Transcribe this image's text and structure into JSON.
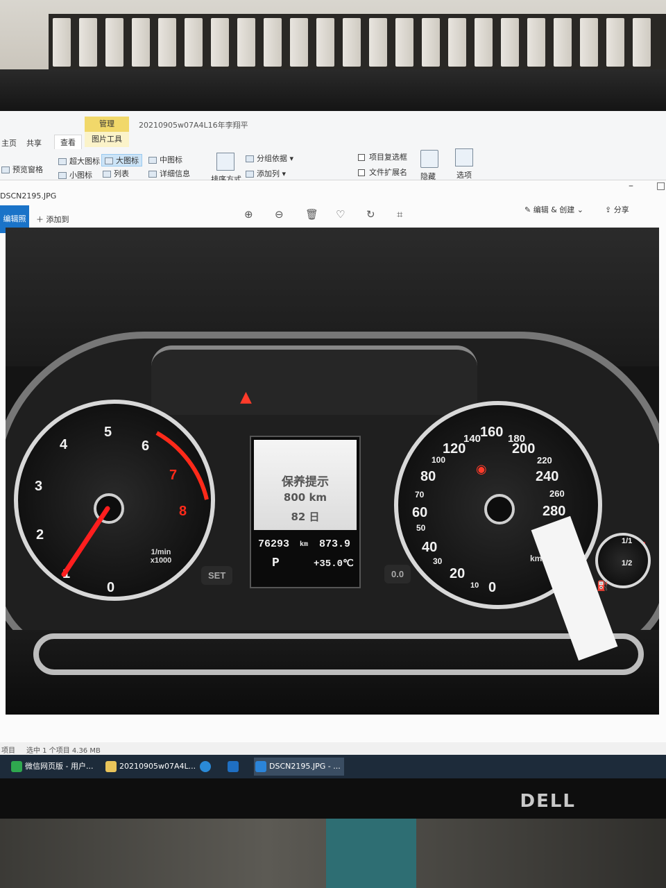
{
  "explorer": {
    "window_title": "20210905w07A4L16年李翔平",
    "context_tab": "管理",
    "context_tab_group": "图片工具",
    "tabs": [
      "主页",
      "共享",
      "查看"
    ],
    "panes": {
      "preview": "预览窗格"
    },
    "layout": {
      "extra_large": "超大图标",
      "large": "大图标",
      "medium": "中图标",
      "small": "小图标",
      "list": "列表",
      "details": "详细信息"
    },
    "current_view": {
      "sort": "排序方式",
      "group_by": "分组依据 ▾",
      "add_columns": "添加列 ▾"
    },
    "show_hide": {
      "item_checkboxes": "项目复选框",
      "file_extensions": "文件扩展名",
      "hide": "隐藏",
      "options": "选项"
    },
    "status": {
      "items": "项目",
      "selected": "选中 1 个项目  4.36 MB"
    }
  },
  "photos_app": {
    "file_name": "DSCN2195.JPG",
    "left_button": "编辑照片",
    "add_to": "添加到",
    "edit_create": "编辑 & 创建",
    "share": "分享",
    "tool_icons": [
      "zoom-in-icon",
      "zoom-out-icon",
      "delete-icon",
      "favorite-icon",
      "rotate-icon",
      "crop-icon"
    ]
  },
  "photo": {
    "tachometer": {
      "numbers": [
        "0",
        "1",
        "2",
        "3",
        "4",
        "5",
        "6",
        "7",
        "8"
      ],
      "unit_line1": "1/min",
      "unit_line2": "x1000"
    },
    "speedometer": {
      "numbers_large": [
        "20",
        "40",
        "60",
        "80",
        "120",
        "160",
        "200",
        "240",
        "280"
      ],
      "numbers_small": [
        "10",
        "30",
        "50",
        "70",
        "100",
        "140",
        "180",
        "220",
        "260"
      ],
      "zero": "0",
      "unit": "km/h"
    },
    "fuel": {
      "full": "1/1",
      "half": "1/2"
    },
    "center_display": {
      "line1": "保养提示",
      "line2": "800 km",
      "line3": "82 日",
      "odometer": "76293",
      "odometer_unit": "km",
      "trip": "873.9",
      "gear": "P",
      "temperature": "+35.0℃"
    },
    "buttons": {
      "set": "SET",
      "reset": "0.0"
    }
  },
  "taskbar": {
    "items": [
      "微信网页版 - 用户...",
      "20210905w07A4L...",
      "DSCN2195.JPG - ..."
    ]
  },
  "monitor_brand": "DELL",
  "colors": {
    "accent": "#1a73c8",
    "manage_tab": "#f1d86a",
    "redline": "#ff2a1a"
  }
}
